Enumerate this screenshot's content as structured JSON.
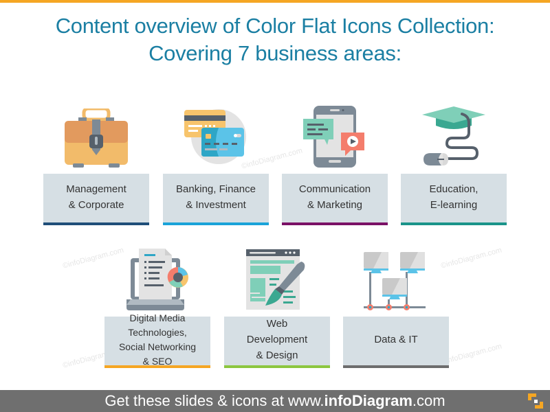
{
  "title": {
    "line1": "Content overview of Color Flat Icons Collection:",
    "line2": "Covering 7 business areas:"
  },
  "areas": [
    {
      "icon": "briefcase-icon",
      "line1": "Management",
      "line2": "& Corporate",
      "line3": "",
      "line4": "",
      "accent": "#1f4e79"
    },
    {
      "icon": "credit-cards-icon",
      "line1": "Banking, Finance",
      "line2": "& Investment",
      "line3": "",
      "line4": "",
      "accent": "#1aa3d9"
    },
    {
      "icon": "smartphone-chat-icon",
      "line1": "Communication",
      "line2": "& Marketing",
      "line3": "",
      "line4": "",
      "accent": "#7b1166"
    },
    {
      "icon": "graduation-cap-mouse-icon",
      "line1": "Education,",
      "line2": "E-learning",
      "line3": "",
      "line4": "",
      "accent": "#1a948a"
    },
    {
      "icon": "laptop-document-chart-icon",
      "line1": "Digital Media",
      "line2": "Technologies,",
      "line3": "Social Networking",
      "line4": "& SEO",
      "accent": "#f5a623"
    },
    {
      "icon": "webpage-brush-icon",
      "line1": "Web",
      "line2": "Development",
      "line3": "& Design",
      "line4": "",
      "accent": "#8cc63f"
    },
    {
      "icon": "network-computers-icon",
      "line1": "Data & IT",
      "line2": "",
      "line3": "",
      "line4": "",
      "accent": "#6d6d6d"
    }
  ],
  "footer": {
    "prefix": "Get these slides & icons at www.",
    "brand": "infoDiagram",
    "suffix": ".com"
  },
  "watermark": "©infoDiagram.com",
  "colors": {
    "top_bar": "#f5a623",
    "title": "#1b7fa3",
    "label_bg": "#d6dfe4",
    "footer_bg": "#6f6f6f"
  }
}
